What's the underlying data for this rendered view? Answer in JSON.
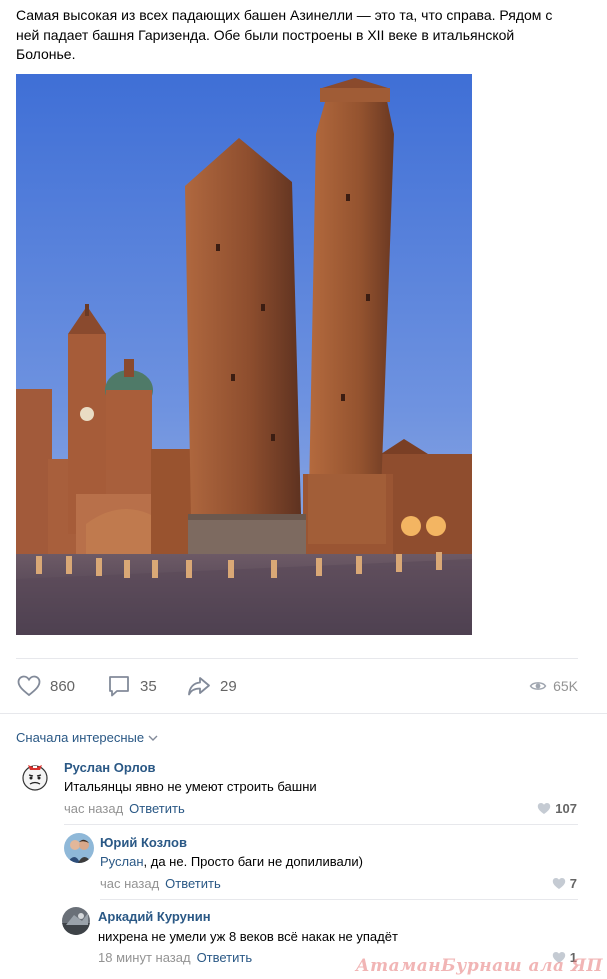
{
  "post": {
    "text": "Самая высокая из всех падающих башен Азинелли — это та, что справа. Рядом с ней падает башня Гаризенда. Обе были построены в XII веке в итальянской Болонье."
  },
  "actions": {
    "likes": "860",
    "comments": "35",
    "shares": "29",
    "views": "65K",
    "like_icon": "heart-icon",
    "comment_icon": "comment-bubble-icon",
    "share_icon": "share-arrow-icon",
    "views_icon": "eye-icon"
  },
  "comments_sort": {
    "label": "Сначала интересные"
  },
  "comments": [
    {
      "author": "Руслан Орлов",
      "text": "Итальянцы явно не умеют строить башни",
      "time": "час назад",
      "reply": "Ответить",
      "likes": "107"
    },
    {
      "author": "Юрий Козлов",
      "mention": "Руслан",
      "text": ", да не. Просто баги не допиливали)",
      "time": "час назад",
      "reply": "Ответить",
      "likes": "7"
    },
    {
      "author": "Аркадий Курунин",
      "text": "нихрена не умели уж 8 веков всё накак не упадёт",
      "time": "18 минут назад",
      "reply": "Ответить",
      "likes": "1"
    }
  ],
  "watermark": {
    "text": "АтаманБурнаш ала ЯП"
  },
  "colors": {
    "link": "#2a5885",
    "meta": "#939393",
    "divider": "#e7e8ec",
    "sky": "#4a78d8",
    "brick": "#8a4a2c"
  }
}
